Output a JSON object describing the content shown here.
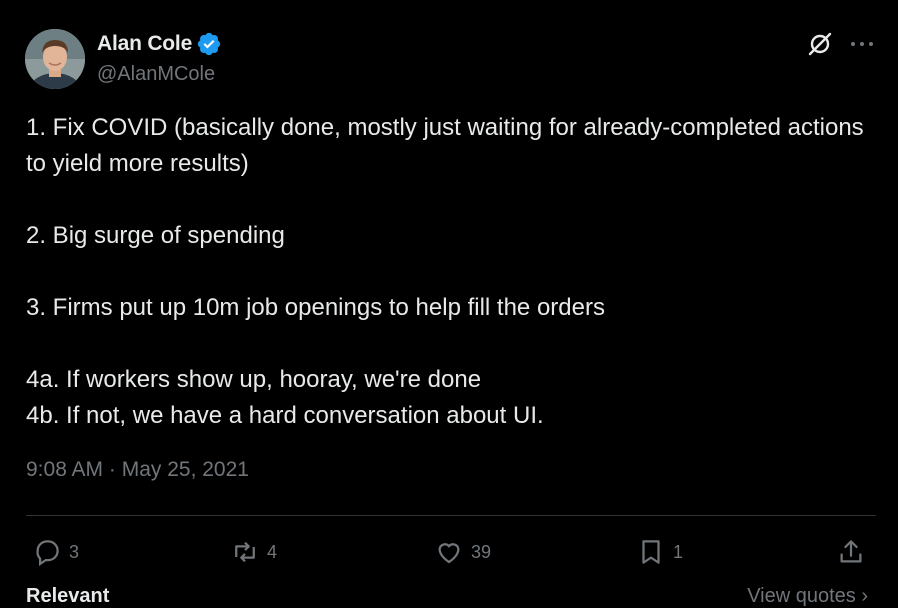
{
  "author": {
    "name": "Alan Cole",
    "handle": "@AlanMCole"
  },
  "tweet": {
    "lines": [
      "1. Fix COVID (basically done, mostly just waiting for already-completed actions to yield more results)",
      "",
      "2. Big surge of spending",
      "",
      "3. Firms put up 10m job openings to help fill the orders",
      "",
      "4a. If workers show up, hooray, we're done",
      "4b. If not, we have a hard conversation about UI."
    ],
    "timestamp": "9:08 AM · May 25, 2021"
  },
  "actions": {
    "replies": "3",
    "reposts": "4",
    "likes": "39",
    "bookmarks": "1"
  },
  "footer": {
    "left": "Relevant",
    "right": "View quotes ›"
  },
  "colors": {
    "background": "#000000",
    "text": "#e7e9ea",
    "muted": "#71767b",
    "verified": "#1d9bf0",
    "divider": "#2f3336"
  },
  "icons": [
    "verified-badge-icon",
    "grok-icon",
    "more-icon",
    "reply-icon",
    "repost-icon",
    "like-icon",
    "bookmark-icon",
    "share-icon"
  ]
}
